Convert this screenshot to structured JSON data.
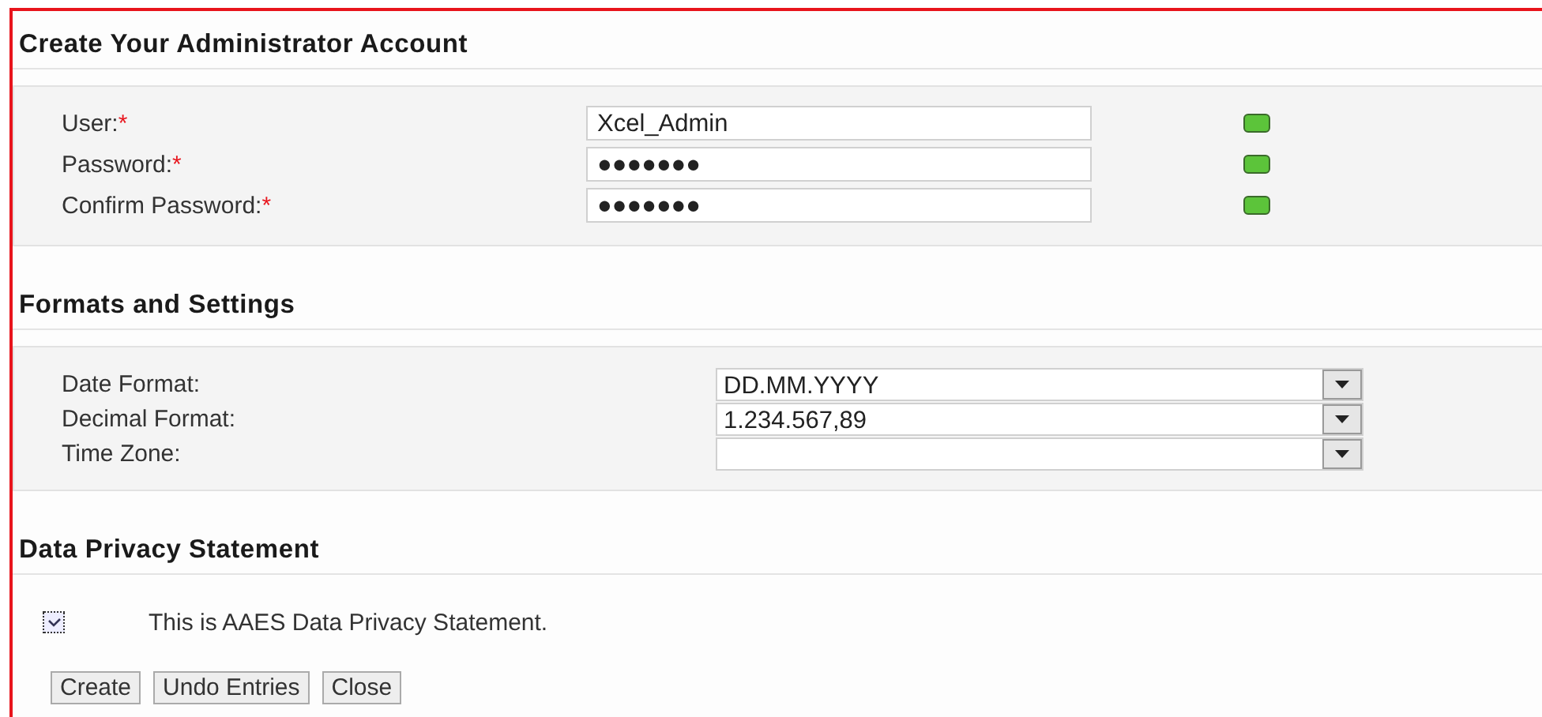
{
  "sections": [
    {
      "kind": "account",
      "title": "Create Your Administrator Account",
      "fields": [
        {
          "label": "User:",
          "required_mark": "*",
          "value": "Xcel_Admin",
          "valid": true
        },
        {
          "label": "Password:",
          "required_mark": "*",
          "value": "●●●●●●●",
          "valid": true
        },
        {
          "label": "Confirm Password:",
          "required_mark": "*",
          "value": "●●●●●●●",
          "valid": true
        }
      ]
    },
    {
      "kind": "formats",
      "title": "Formats and Settings",
      "fields": [
        {
          "label": "Date Format:",
          "value": "DD.MM.YYYY"
        },
        {
          "label": "Decimal Format:",
          "value": "1.234.567,89"
        },
        {
          "label": "Time Zone:"
        }
      ]
    },
    {
      "kind": "privacy",
      "title": "Data Privacy Statement",
      "checkbox": {
        "label": "This is AAES Data Privacy Statement.",
        "checked": true
      }
    }
  ],
  "buttons": [
    "Create",
    "Undo Entries",
    "Close"
  ]
}
